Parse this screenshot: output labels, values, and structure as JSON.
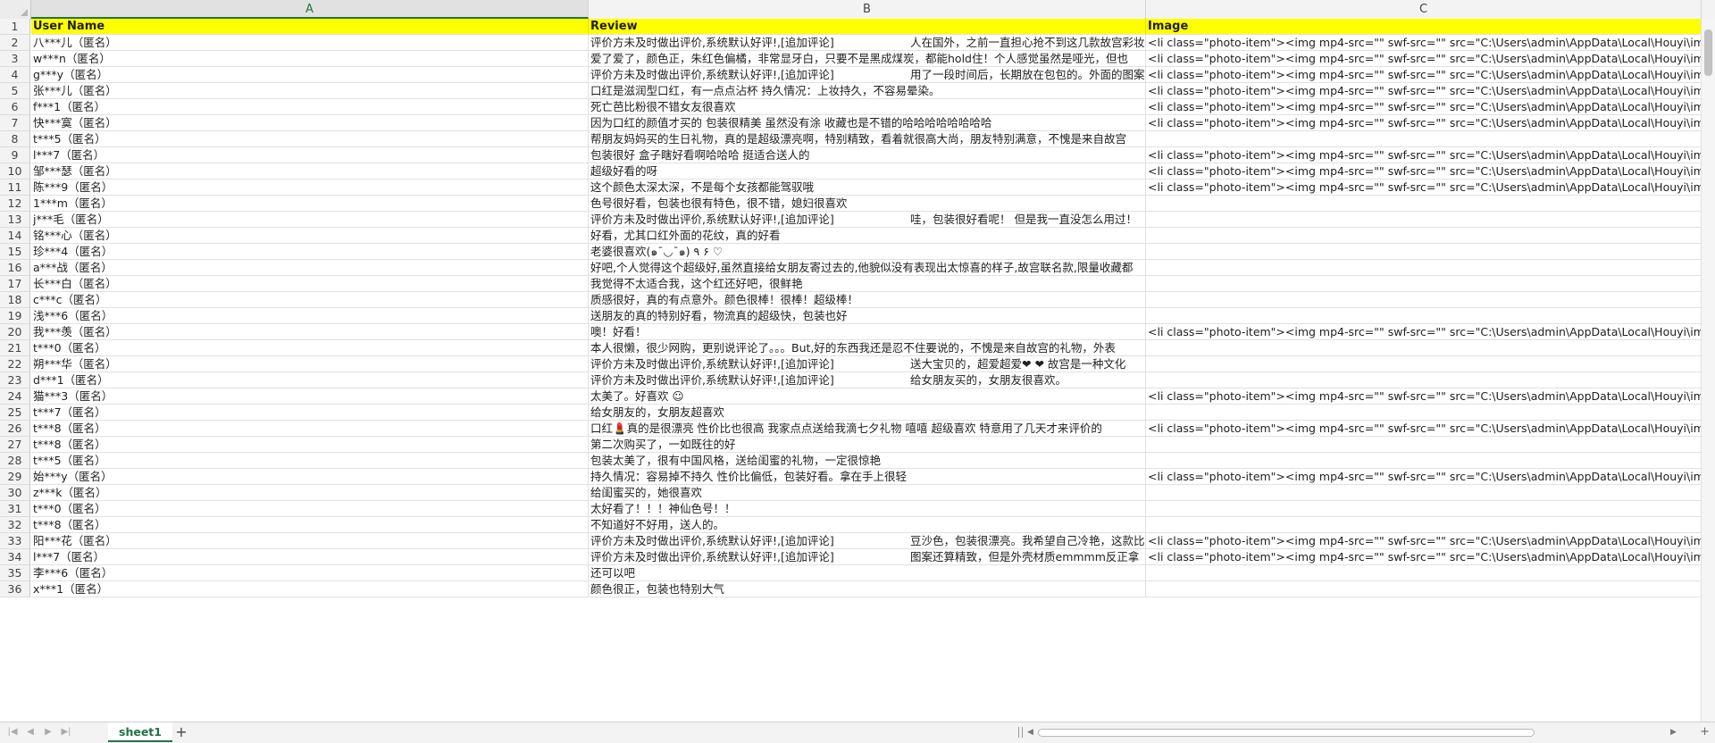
{
  "sheet": {
    "columns": [
      "A",
      "B",
      "C"
    ],
    "selected_column": "A",
    "header": {
      "row_number": "1",
      "A": "User Name",
      "B": "Review",
      "C": "Image"
    },
    "rows": [
      {
        "n": "2",
        "A": "八***儿（匿名）",
        "B": "评价方未及时做出评价,系统默认好评!,[追加评论]",
        "B2": "人在国外，之前一直担心抢不到这几款故宫彩妆",
        "C": "<li class=\"photo-item\"><img mp4-src=\"\" swf-src=\"\" src=\"C:\\Users\\admin\\AppData\\Local\\Houyi\\im"
      },
      {
        "n": "3",
        "A": "w***n（匿名）",
        "B": "爱了爱了，颜色正，朱红色偏橘，非常显牙白，只要不是黑成煤炭，都能hold住！个人感觉虽然是哑光，但也",
        "B2": "",
        "C": "<li class=\"photo-item\"><img mp4-src=\"\" swf-src=\"\" src=\"C:\\Users\\admin\\AppData\\Local\\Houyi\\im"
      },
      {
        "n": "4",
        "A": "g***y（匿名）",
        "B": "评价方未及时做出评价,系统默认好评!,[追加评论]",
        "B2": "用了一段时间后，长期放在包包的。外面的图案",
        "C": "<li class=\"photo-item\"><img mp4-src=\"\" swf-src=\"\" src=\"C:\\Users\\admin\\AppData\\Local\\Houyi\\im"
      },
      {
        "n": "5",
        "A": "张***儿（匿名）",
        "B": "口红是滋润型口红，有一点点沾杯 持久情况：上妆持久，不容易晕染。",
        "B2": "",
        "C": "<li class=\"photo-item\"><img mp4-src=\"\" swf-src=\"\" src=\"C:\\Users\\admin\\AppData\\Local\\Houyi\\im"
      },
      {
        "n": "6",
        "A": "f***1（匿名）",
        "B": "死亡芭比粉很不错女友很喜欢",
        "B2": "",
        "C": "<li class=\"photo-item\"><img mp4-src=\"\" swf-src=\"\" src=\"C:\\Users\\admin\\AppData\\Local\\Houyi\\im"
      },
      {
        "n": "7",
        "A": "快***寞（匿名）",
        "B": "因为口红的颜值才买的 包装很精美 虽然没有涂 收藏也是不错的哈哈哈哈哈哈哈哈",
        "B2": "",
        "C": "<li class=\"photo-item\"><img mp4-src=\"\" swf-src=\"\" src=\"C:\\Users\\admin\\AppData\\Local\\Houyi\\im"
      },
      {
        "n": "8",
        "A": "t***5（匿名）",
        "B": "帮朋友妈妈买的生日礼物，真的是超级漂亮啊，特别精致，看着就很高大尚，朋友特别满意，不愧是来自故宫",
        "B2": "",
        "C": ""
      },
      {
        "n": "9",
        "A": "l***7（匿名）",
        "B": "包装很好 盒子瞎好看啊哈哈哈 挺适合送人的",
        "B2": "",
        "C": "<li class=\"photo-item\"><img mp4-src=\"\" swf-src=\"\" src=\"C:\\Users\\admin\\AppData\\Local\\Houyi\\im"
      },
      {
        "n": "10",
        "A": "邹***瑟（匿名）",
        "B": "超级好看的呀",
        "B2": "",
        "C": "<li class=\"photo-item\"><img mp4-src=\"\" swf-src=\"\" src=\"C:\\Users\\admin\\AppData\\Local\\Houyi\\im"
      },
      {
        "n": "11",
        "A": "陈***9（匿名）",
        "B": "这个颜色太深太深，不是每个女孩都能驾驭哦",
        "B2": "",
        "C": "<li class=\"photo-item\"><img mp4-src=\"\" swf-src=\"\" src=\"C:\\Users\\admin\\AppData\\Local\\Houyi\\im"
      },
      {
        "n": "12",
        "A": "1***m（匿名）",
        "B": "色号很好看，包装也很有特色，很不错，媳妇很喜欢",
        "B2": "",
        "C": ""
      },
      {
        "n": "13",
        "A": "j***毛（匿名）",
        "B": "评价方未及时做出评价,系统默认好评!,[追加评论]",
        "B2": "哇，包装很好看呢！ 但是我一直没怎么用过！",
        "C": ""
      },
      {
        "n": "14",
        "A": "铭***心（匿名）",
        "B": "好看，尤其口红外面的花纹，真的好看",
        "B2": "",
        "C": ""
      },
      {
        "n": "15",
        "A": "珍***4（匿名）",
        "B": "老婆很喜欢(๑¯◡¯๑) ٩ ۶ ♡",
        "B2": "",
        "C": ""
      },
      {
        "n": "16",
        "A": "a***战（匿名）",
        "B": "好吧,个人觉得这个超级好,虽然直接给女朋友寄过去的,他貌似没有表现出太惊喜的样子,故宫联名款,限量收藏都",
        "B2": "",
        "C": ""
      },
      {
        "n": "17",
        "A": "长***白（匿名）",
        "B": "我觉得不太适合我，这个红还好吧，很鲜艳",
        "B2": "",
        "C": ""
      },
      {
        "n": "18",
        "A": "c***c（匿名）",
        "B": "质感很好，真的有点意外。颜色很棒！很棒！超级棒！",
        "B2": "",
        "C": ""
      },
      {
        "n": "19",
        "A": "浅***6（匿名）",
        "B": "送朋友的真的特别好看，物流真的超级快，包装也好",
        "B2": "",
        "C": ""
      },
      {
        "n": "20",
        "A": "我***羡（匿名）",
        "B": "噢！好看！",
        "B2": "",
        "C": "<li class=\"photo-item\"><img mp4-src=\"\" swf-src=\"\" src=\"C:\\Users\\admin\\AppData\\Local\\Houyi\\im"
      },
      {
        "n": "21",
        "A": "t***0（匿名）",
        "B": "本人很懒，很少网购，更别说评论了。。。But,好的东西我还是忍不住要说的，不愧是来自故宫的礼物，外表",
        "B2": "",
        "C": ""
      },
      {
        "n": "22",
        "A": "朔***华（匿名）",
        "B": "评价方未及时做出评价,系统默认好评!,[追加评论]",
        "B2": "送大宝贝的，超爱超爱❤ ❤ 故宫是一种文化",
        "C": ""
      },
      {
        "n": "23",
        "A": "d***1（匿名）",
        "B": "评价方未及时做出评价,系统默认好评!,[追加评论]",
        "B2": "给女朋友买的，女朋友很喜欢。",
        "C": ""
      },
      {
        "n": "24",
        "A": "猫***3（匿名）",
        "B": "太美了。好喜欢 ☺",
        "B2": "",
        "C": "<li class=\"photo-item\"><img mp4-src=\"\" swf-src=\"\" src=\"C:\\Users\\admin\\AppData\\Local\\Houyi\\im"
      },
      {
        "n": "25",
        "A": "t***7（匿名）",
        "B": "给女朋友的，女朋友超喜欢",
        "B2": "",
        "C": ""
      },
      {
        "n": "26",
        "A": "t***8（匿名）",
        "B": "口红💄真的是很漂亮  性价比也很高   我家点点送给我滴七夕礼物   嘻嘻   超级喜欢   特意用了几天才来评价的",
        "B2": "",
        "C": "<li class=\"photo-item\"><img mp4-src=\"\" swf-src=\"\" src=\"C:\\Users\\admin\\AppData\\Local\\Houyi\\im"
      },
      {
        "n": "27",
        "A": "t***8（匿名）",
        "B": "第二次购买了，一如既往的好",
        "B2": "",
        "C": ""
      },
      {
        "n": "28",
        "A": "t***5（匿名）",
        "B": "包装太美了，很有中国风格，送给闺蜜的礼物，一定很惊艳",
        "B2": "",
        "C": ""
      },
      {
        "n": "29",
        "A": "始***y（匿名）",
        "B": "持久情况：容易掉不持久 性价比偏低，包装好看。拿在手上很轻",
        "B2": "",
        "C": "<li class=\"photo-item\"><img mp4-src=\"\" swf-src=\"\" src=\"C:\\Users\\admin\\AppData\\Local\\Houyi\\im"
      },
      {
        "n": "30",
        "A": "z***k（匿名）",
        "B": "给闺蜜买的，她很喜欢",
        "B2": "",
        "C": ""
      },
      {
        "n": "31",
        "A": "t***0（匿名）",
        "B": "太好看了！！！神仙色号！！",
        "B2": "",
        "C": ""
      },
      {
        "n": "32",
        "A": "t***8（匿名）",
        "B": "不知道好不好用，送人的。",
        "B2": "",
        "C": ""
      },
      {
        "n": "33",
        "A": "阳***花（匿名）",
        "B": "评价方未及时做出评价,系统默认好评!,[追加评论]",
        "B2": "豆沙色，包装很漂亮。我希望自己冷艳，这款比较",
        "C": "<li class=\"photo-item\"><img mp4-src=\"\" swf-src=\"\" src=\"C:\\Users\\admin\\AppData\\Local\\Houyi\\im"
      },
      {
        "n": "34",
        "A": "l***7（匿名）",
        "B": "评价方未及时做出评价,系统默认好评!,[追加评论]",
        "B2": "图案还算精致，但是外壳材质emmmm反正拿",
        "C": "<li class=\"photo-item\"><img mp4-src=\"\" swf-src=\"\" src=\"C:\\Users\\admin\\AppData\\Local\\Houyi\\im"
      },
      {
        "n": "35",
        "A": "李***6（匿名）",
        "B": "还可以吧",
        "B2": "",
        "C": ""
      },
      {
        "n": "36",
        "A": "x***1（匿名）",
        "B": "颜色很正，包装也特别大气",
        "B2": "",
        "C": ""
      }
    ]
  },
  "bottom_bar": {
    "sheet_tab": "sheet1",
    "add_sheet": "+"
  },
  "colors": {
    "header_fill": "#ffff00",
    "accent": "#217346"
  }
}
